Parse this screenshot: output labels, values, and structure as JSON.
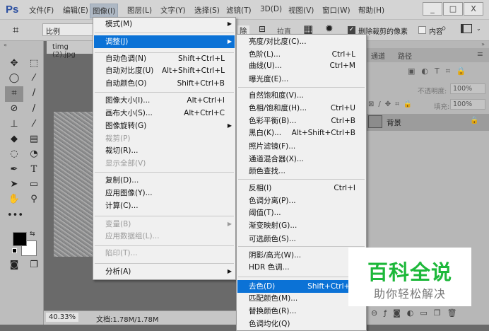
{
  "app": {
    "logo": "Ps",
    "window_buttons": [
      "_",
      "□",
      "X"
    ]
  },
  "menubar": [
    "文件(F)",
    "编辑(E)",
    "图像(I)",
    "图层(L)",
    "文字(Y)",
    "选择(S)",
    "滤镜(T)",
    "3D(D)",
    "视图(V)",
    "窗口(W)",
    "帮助(H)"
  ],
  "options": {
    "ratio": "比例",
    "clear_partial": "除",
    "straighten": "拉直",
    "delete_cropped": "删除裁剪的像素",
    "content_aware": "内容",
    "delete_checked": true,
    "content_checked": false
  },
  "document": {
    "tab": "timg (2).jpg",
    "zoom": "40.33%",
    "info": "文档:1.78M/1.78M"
  },
  "image_menu": [
    {
      "label": "模式(M)",
      "sub": true
    },
    {
      "sep": true
    },
    {
      "label": "调整(J)",
      "sub": true,
      "highlight": true
    },
    {
      "sep": true
    },
    {
      "label": "自动色调(N)",
      "shortcut": "Shift+Ctrl+L"
    },
    {
      "label": "自动对比度(U)",
      "shortcut": "Alt+Shift+Ctrl+L"
    },
    {
      "label": "自动颜色(O)",
      "shortcut": "Shift+Ctrl+B"
    },
    {
      "sep": true
    },
    {
      "label": "图像大小(I)...",
      "shortcut": "Alt+Ctrl+I"
    },
    {
      "label": "画布大小(S)...",
      "shortcut": "Alt+Ctrl+C"
    },
    {
      "label": "图像旋转(G)",
      "sub": true
    },
    {
      "label": "裁剪(P)",
      "disabled": true
    },
    {
      "label": "裁切(R)..."
    },
    {
      "label": "显示全部(V)",
      "disabled": true
    },
    {
      "sep": true
    },
    {
      "label": "复制(D)..."
    },
    {
      "label": "应用图像(Y)..."
    },
    {
      "label": "计算(C)..."
    },
    {
      "sep": true
    },
    {
      "label": "变量(B)",
      "sub": true,
      "disabled": true
    },
    {
      "label": "应用数据组(L)...",
      "disabled": true
    },
    {
      "sep": true
    },
    {
      "label": "陷印(T)...",
      "disabled": true
    },
    {
      "sep": true
    },
    {
      "label": "分析(A)",
      "sub": true
    }
  ],
  "adjust_menu": [
    {
      "label": "亮度/对比度(C)..."
    },
    {
      "label": "色阶(L)...",
      "shortcut": "Ctrl+L"
    },
    {
      "label": "曲线(U)...",
      "shortcut": "Ctrl+M"
    },
    {
      "label": "曝光度(E)..."
    },
    {
      "sep": true
    },
    {
      "label": "自然饱和度(V)..."
    },
    {
      "label": "色相/饱和度(H)...",
      "shortcut": "Ctrl+U"
    },
    {
      "label": "色彩平衡(B)...",
      "shortcut": "Ctrl+B"
    },
    {
      "label": "黑白(K)...",
      "shortcut": "Alt+Shift+Ctrl+B"
    },
    {
      "label": "照片滤镜(F)..."
    },
    {
      "label": "通道混合器(X)..."
    },
    {
      "label": "颜色查找..."
    },
    {
      "sep": true
    },
    {
      "label": "反相(I)",
      "shortcut": "Ctrl+I"
    },
    {
      "label": "色调分离(P)..."
    },
    {
      "label": "阈值(T)..."
    },
    {
      "label": "渐变映射(G)..."
    },
    {
      "label": "可选颜色(S)..."
    },
    {
      "sep": true
    },
    {
      "label": "阴影/高光(W)..."
    },
    {
      "label": "HDR 色调..."
    },
    {
      "sep": true
    },
    {
      "label": "去色(D)",
      "shortcut": "Shift+Ctrl+U",
      "highlight": true
    },
    {
      "label": "匹配颜色(M)..."
    },
    {
      "label": "替换颜色(R)..."
    },
    {
      "label": "色调均化(Q)"
    }
  ],
  "panel": {
    "tabs": [
      "通道",
      "路径"
    ],
    "opacity_label": "不透明度:",
    "opacity": "100%",
    "fill_label": "填充:",
    "fill": "100%",
    "layer_name": "背景"
  },
  "watermark": {
    "title": "百科全说",
    "subtitle": "助你轻松解决"
  },
  "colors": {
    "accent": "#0b72d6",
    "watermark": "#1db83a"
  }
}
